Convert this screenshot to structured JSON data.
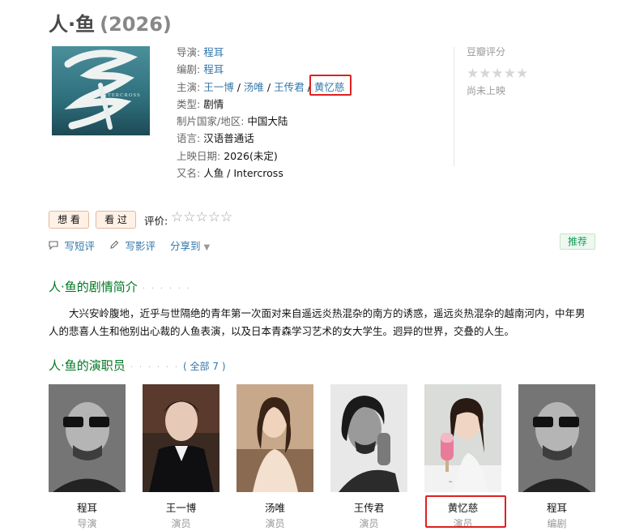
{
  "movie": {
    "title": "人·鱼",
    "year": "(2026)"
  },
  "info": {
    "director_label": "导演:",
    "director": "程耳",
    "writer_label": "编剧:",
    "writer": "程耳",
    "cast_label": "主演:",
    "cast": [
      "王一博",
      "汤唯",
      "王传君",
      "黄忆慈"
    ],
    "separator": "/",
    "genre_label": "类型:",
    "genre": "剧情",
    "region_label": "制片国家/地区:",
    "region": "中国大陆",
    "language_label": "语言:",
    "language": "汉语普通话",
    "release_label": "上映日期:",
    "release": "2026(未定)",
    "aka_label": "又名:",
    "aka": "人鱼 / Intercross"
  },
  "poster": {
    "text": "INTERCROSS"
  },
  "rating": {
    "title": "豆瓣评分",
    "stars": "★★★★★",
    "status": "尚未上映"
  },
  "actions": {
    "want": "想 看",
    "seen": "看 过",
    "rate_label": "评价:",
    "rate_stars": "☆☆☆☆☆",
    "short_review": "写短评",
    "review": "写影评",
    "share": "分享到",
    "recommend": "推荐"
  },
  "intro": {
    "title": "人·鱼的剧情简介",
    "dots": "· · · · · ·",
    "text": "大兴安岭腹地，近乎与世隔绝的青年第一次面对来自遥远炎热混杂的南方的诱惑，遥远炎热混杂的越南河内，中年男人的悲喜人生和他别出心裁的人鱼表演，以及日本青森学习艺术的女大学生。迥异的世界，交叠的人生。"
  },
  "cast_section": {
    "title": "人·鱼的演职员",
    "dots": "· · · · · ·",
    "open": "(",
    "all_link": "全部 7",
    "close": ")"
  },
  "cast_list": [
    {
      "name": "程耳",
      "role": "导演"
    },
    {
      "name": "王一博",
      "role": "演员"
    },
    {
      "name": "汤唯",
      "role": "演员"
    },
    {
      "name": "王传君",
      "role": "演员"
    },
    {
      "name": "黄忆慈",
      "role": "演员"
    },
    {
      "name": "程耳",
      "role": "编剧"
    }
  ],
  "colors": {
    "link": "#3377aa",
    "section_green": "#007722",
    "highlight_red": "#e02020"
  }
}
